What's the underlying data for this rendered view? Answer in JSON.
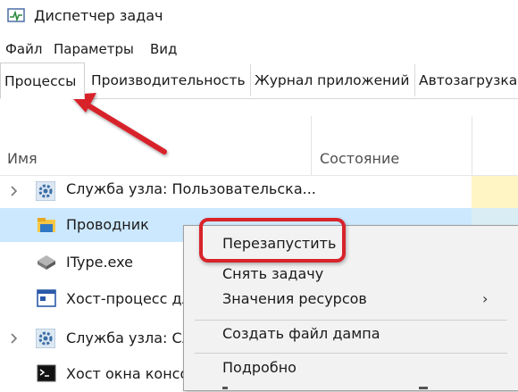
{
  "window": {
    "title": "Диспетчер задач"
  },
  "menubar": {
    "items": [
      "Файл",
      "Параметры",
      "Вид"
    ]
  },
  "tabs": [
    "Процессы",
    "Производительность",
    "Журнал приложений",
    "Автозагрузка"
  ],
  "columns": {
    "name": "Имя",
    "status": "Состояние"
  },
  "processes": [
    {
      "name": "Служба узла: Пользовательска...",
      "icon": "gear-icon",
      "expandable": true
    },
    {
      "name": "Проводник",
      "icon": "folder-icon",
      "expandable": false,
      "selected": true
    },
    {
      "name": "IType.exe",
      "icon": "disk-icon",
      "expandable": false
    },
    {
      "name": "Хост-процесс дл",
      "icon": "window-icon",
      "expandable": false
    },
    {
      "name": "Служба узла: Сл",
      "icon": "gear-icon",
      "expandable": true
    },
    {
      "name": "Хост окна консо",
      "icon": "console-icon",
      "expandable": false
    }
  ],
  "context_menu": {
    "items": [
      "Перезапустить",
      "Снять задачу",
      "Значения ресурсов",
      "Создать файл дампа",
      "Подробно"
    ],
    "submenu_arrow": "›"
  },
  "colors": {
    "selection": "#cce8ff",
    "highlight_red": "#d8232a",
    "status_column": "#fff4c4"
  }
}
